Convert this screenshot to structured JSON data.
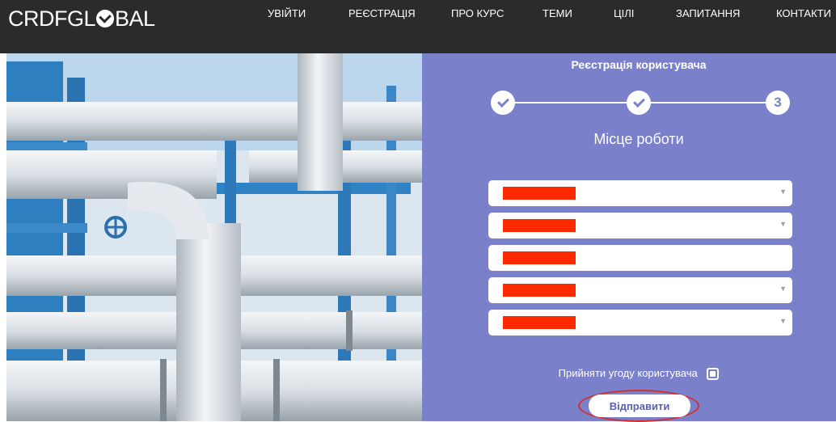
{
  "header": {
    "logo_text_left": "CRDFGL",
    "logo_text_right": "BAL",
    "nav": [
      "УВІЙТИ",
      "РЕЄСТРАЦІЯ",
      "ПРО КУРС",
      "ТЕМИ",
      "ЦІЛІ",
      "ЗАПИТАННЯ",
      "КОНТАКТИ"
    ]
  },
  "registration": {
    "title": "Реєстрація користувача",
    "current_step_number": "3",
    "step_subtitle": "Місце роботи",
    "fields": [
      {
        "type": "select",
        "value_redacted": true
      },
      {
        "type": "select",
        "value_redacted": true
      },
      {
        "type": "text",
        "value_redacted": true
      },
      {
        "type": "select",
        "value_redacted": true
      },
      {
        "type": "select",
        "value_redacted": true
      }
    ],
    "agree_label": "Прийняти угоду користувача",
    "submit_label": "Відправити"
  },
  "colors": {
    "header_bg": "#2b2b2b",
    "panel_bg": "#7a80c9",
    "redaction": "#ff2a00",
    "highlight_ring": "#d32f2f"
  },
  "icons": [
    "check-icon",
    "select-caret-icon",
    "logo-check-icon"
  ]
}
